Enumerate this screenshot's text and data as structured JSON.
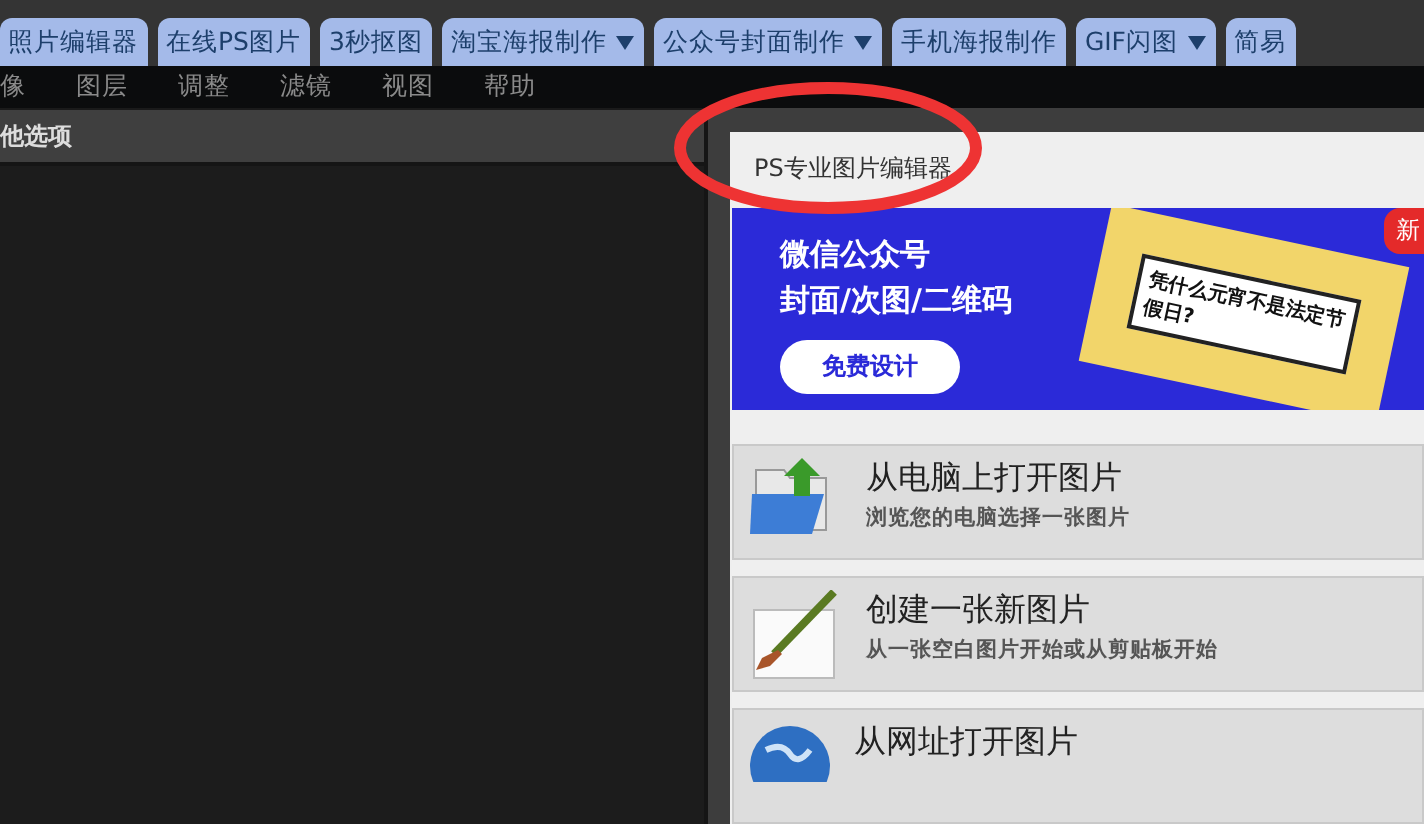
{
  "tabs": [
    {
      "label": "照片编辑器",
      "dropdown": false
    },
    {
      "label": "在线PS图片",
      "dropdown": false
    },
    {
      "label": "3秒抠图",
      "dropdown": false
    },
    {
      "label": "淘宝海报制作",
      "dropdown": true
    },
    {
      "label": "公众号封面制作",
      "dropdown": true
    },
    {
      "label": "手机海报制作",
      "dropdown": false
    },
    {
      "label": "GIF闪图",
      "dropdown": true
    },
    {
      "label": "简易",
      "dropdown": false
    }
  ],
  "menu": [
    "像",
    "图层",
    "调整",
    "滤镜",
    "视图",
    "帮助"
  ],
  "left_panel": {
    "title": "他选项"
  },
  "dialog": {
    "title": "PS专业图片编辑器",
    "banner": {
      "headline": "微信公众号",
      "subline": "封面/次图/二维码",
      "button": "免费设计",
      "card_text": "凭什么元宵不是法定节假日?",
      "badge": "新"
    },
    "options": [
      {
        "kind": "open-file",
        "title": "从电脑上打开图片",
        "subtitle": "浏览您的电脑选择一张图片"
      },
      {
        "kind": "new-image",
        "title": "创建一张新图片",
        "subtitle": "从一张空白图片开始或从剪贴板开始"
      },
      {
        "kind": "open-url",
        "title": "从网址打开图片"
      }
    ]
  }
}
